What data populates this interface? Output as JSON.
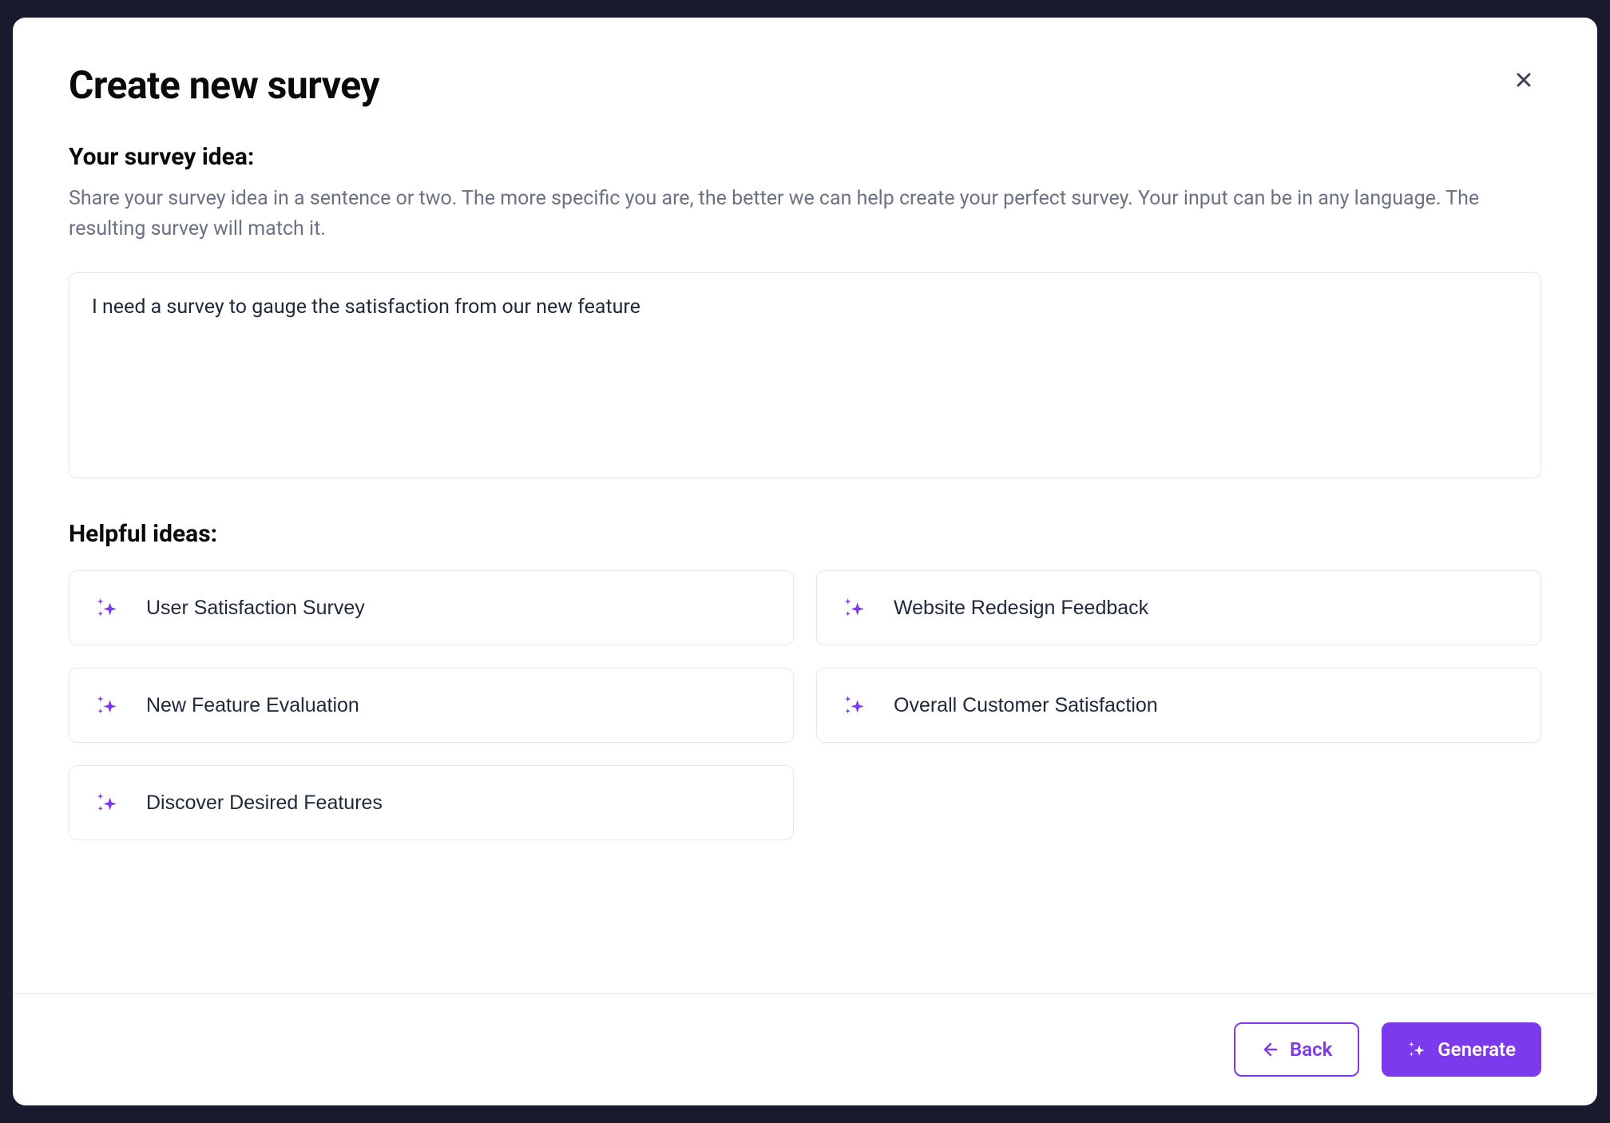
{
  "modal": {
    "title": "Create new survey",
    "idea_section": {
      "label": "Your survey idea:",
      "description": "Share your survey idea in a sentence or two. The more specific you are, the better we can help create your perfect survey. Your input can be in any language. The resulting survey will match it.",
      "value": "I need a survey to gauge the satisfaction from our new feature"
    },
    "helpful_section": {
      "label": "Helpful ideas:",
      "ideas": [
        {
          "label": "User Satisfaction Survey"
        },
        {
          "label": "Website Redesign Feedback"
        },
        {
          "label": "New Feature Evaluation"
        },
        {
          "label": "Overall Customer Satisfaction"
        },
        {
          "label": "Discover Desired Features"
        }
      ]
    },
    "footer": {
      "back_label": "Back",
      "generate_label": "Generate"
    }
  }
}
